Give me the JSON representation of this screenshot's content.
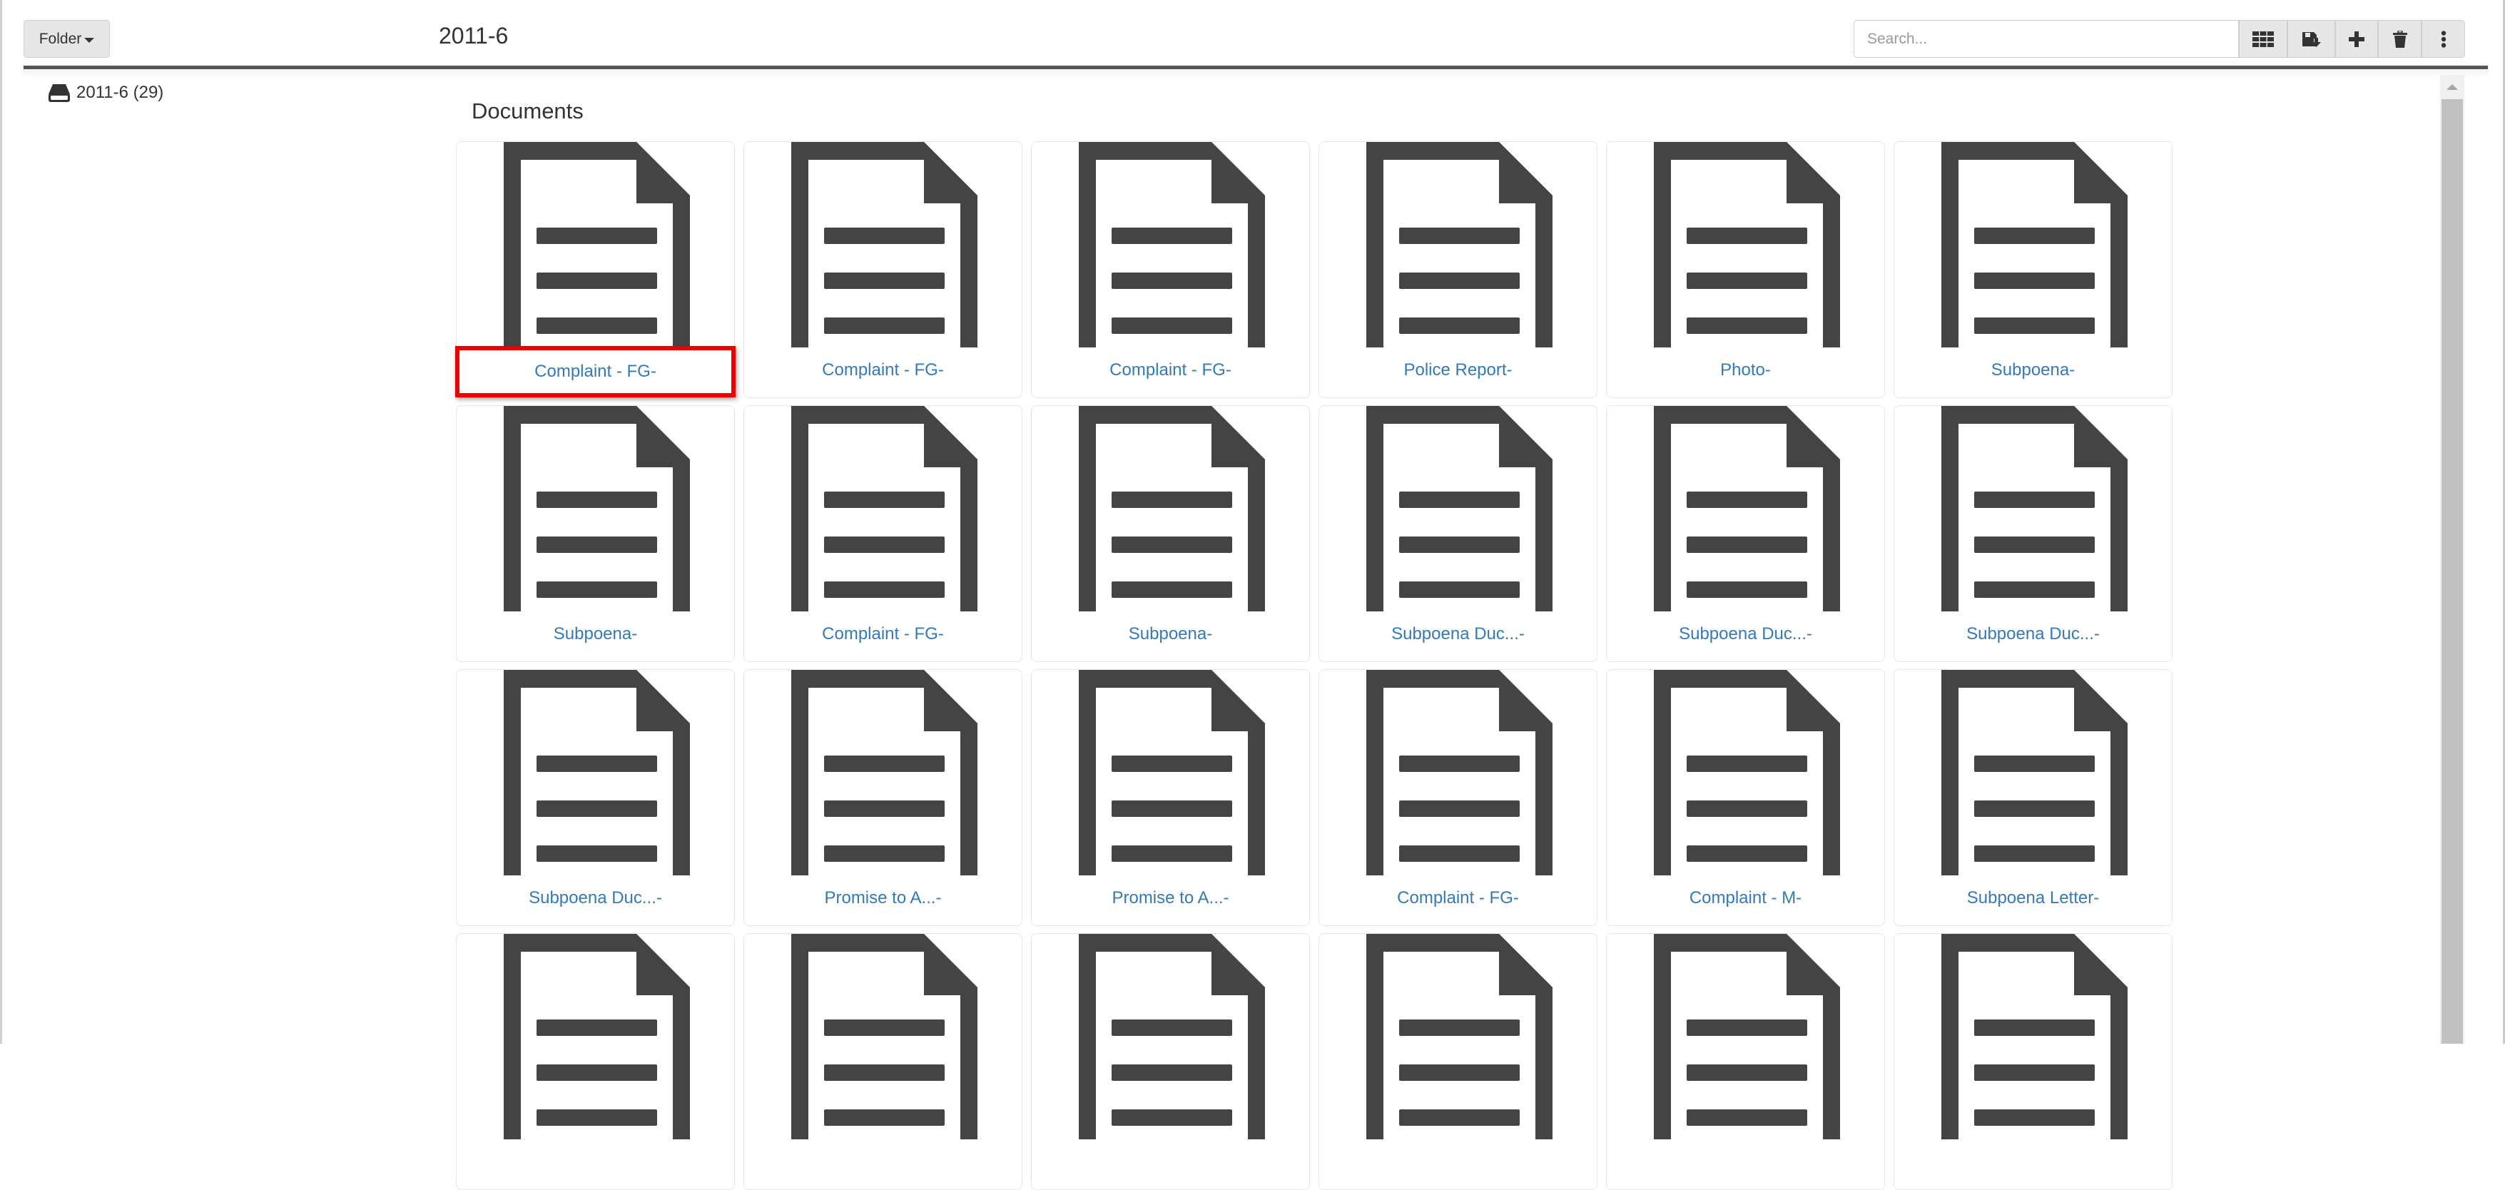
{
  "header": {
    "folder_button": "Folder",
    "title": "2011-6",
    "search_placeholder": "Search...",
    "toolbar_icons": [
      "grid-view-icon",
      "save-download-icon",
      "plus-icon",
      "trash-icon",
      "more-vertical-icon"
    ]
  },
  "sidebar": {
    "tree": [
      {
        "icon": "hdd-icon",
        "label": "2011-6 (29)"
      }
    ]
  },
  "main": {
    "section_title": "Documents",
    "highlight_color": "#ee0000",
    "link_color": "#337ab7",
    "documents": [
      {
        "label": "Complaint - FG-",
        "highlighted": true
      },
      {
        "label": "Complaint - FG-"
      },
      {
        "label": "Complaint - FG-"
      },
      {
        "label": "Police Report-"
      },
      {
        "label": "Photo-"
      },
      {
        "label": "Subpoena-"
      },
      {
        "label": "Subpoena-"
      },
      {
        "label": "Complaint - FG-"
      },
      {
        "label": "Subpoena-"
      },
      {
        "label": "Subpoena Duc...-"
      },
      {
        "label": "Subpoena Duc...-"
      },
      {
        "label": "Subpoena Duc...-"
      },
      {
        "label": "Subpoena Duc...-"
      },
      {
        "label": "Promise to A...-"
      },
      {
        "label": "Promise to A...-"
      },
      {
        "label": "Complaint - FG-"
      },
      {
        "label": "Complaint - M-"
      },
      {
        "label": "Subpoena Letter-"
      },
      {
        "label": ""
      },
      {
        "label": ""
      },
      {
        "label": ""
      },
      {
        "label": ""
      },
      {
        "label": ""
      },
      {
        "label": ""
      }
    ]
  }
}
